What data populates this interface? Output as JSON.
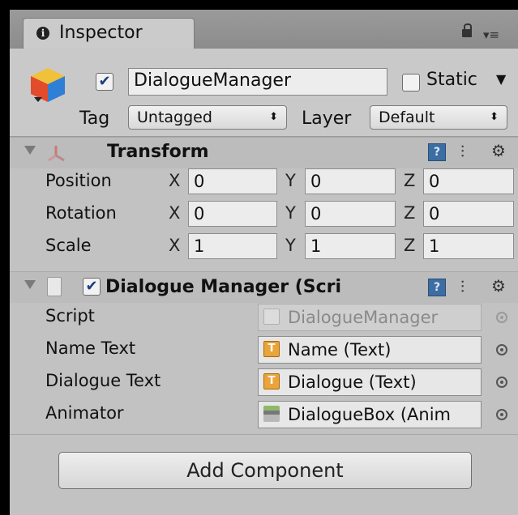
{
  "tab": {
    "title": "Inspector"
  },
  "header": {
    "active": true,
    "name": "DialogueManager",
    "static_label": "Static",
    "static_checked": false,
    "tag_label": "Tag",
    "tag_value": "Untagged",
    "layer_label": "Layer",
    "layer_value": "Default"
  },
  "transform": {
    "title": "Transform",
    "rows": [
      {
        "label": "Position",
        "x": "0",
        "y": "0",
        "z": "0"
      },
      {
        "label": "Rotation",
        "x": "0",
        "y": "0",
        "z": "0"
      },
      {
        "label": "Scale",
        "x": "1",
        "y": "1",
        "z": "1"
      }
    ],
    "axes": {
      "x": "X",
      "y": "Y",
      "z": "Z"
    }
  },
  "dialogue_manager": {
    "enabled": true,
    "title": "Dialogue Manager (Scri",
    "fields": [
      {
        "label": "Script",
        "value": "DialogueManager",
        "icon": "script-icon",
        "disabled": true
      },
      {
        "label": "Name Text",
        "value": "Name (Text)",
        "icon": "text-component-icon",
        "disabled": false
      },
      {
        "label": "Dialogue Text",
        "value": "Dialogue (Text)",
        "icon": "text-component-icon",
        "disabled": false
      },
      {
        "label": "Animator",
        "value": "DialogueBox (Anim",
        "icon": "animator-icon",
        "disabled": false
      }
    ]
  },
  "add_component_label": "Add Component",
  "icons": {
    "tab": "info-icon",
    "lock": "lock-icon",
    "menu": "tab-menu-icon",
    "object": "gameobject-cube-icon",
    "transform": "transform-icon",
    "script": "script-file-icon",
    "help": "help-book-icon",
    "presets": "presets-icon",
    "settings": "gear-icon",
    "picker": "object-picker-icon"
  },
  "colors": {
    "panel": "#c2c2c2",
    "header": "#c9c9c9",
    "checkmark": "#1d3f79",
    "help_icon": "#3c6da3"
  }
}
